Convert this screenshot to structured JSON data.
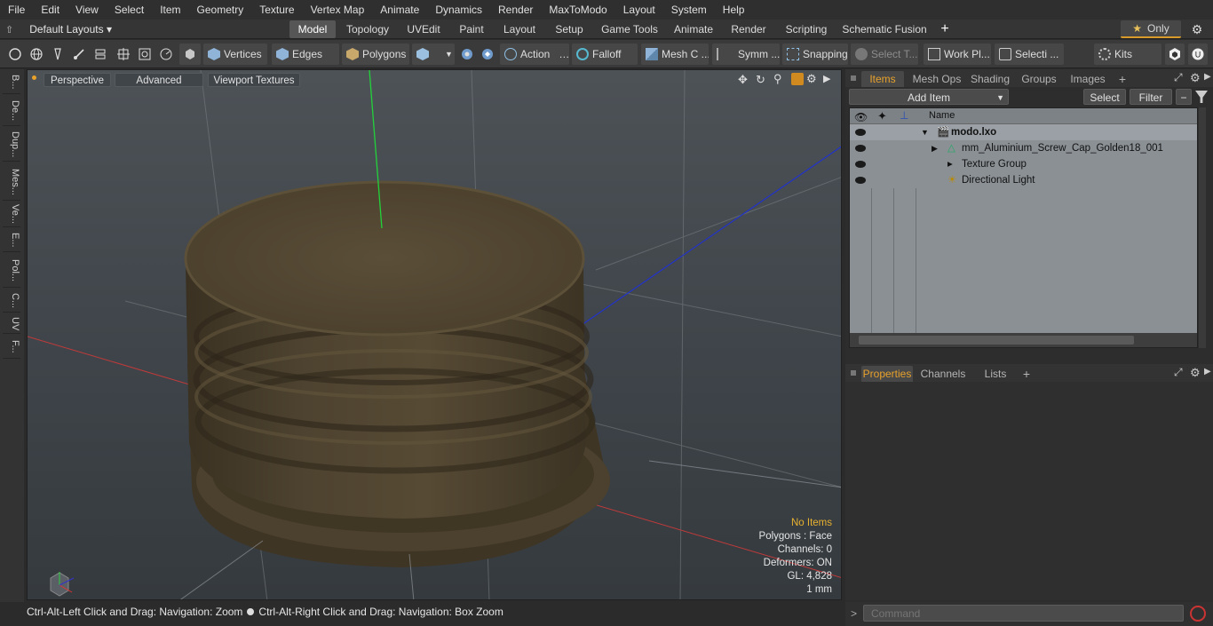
{
  "menu": [
    "File",
    "Edit",
    "View",
    "Select",
    "Item",
    "Geometry",
    "Texture",
    "Vertex Map",
    "Animate",
    "Dynamics",
    "Render",
    "MaxToModo",
    "Layout",
    "System",
    "Help"
  ],
  "layouts": {
    "label": "Default Layouts ▾"
  },
  "mode_tabs": [
    "Model",
    "Topology",
    "UVEdit",
    "Paint",
    "Layout",
    "Setup",
    "Game Tools",
    "Animate",
    "Render",
    "Scripting",
    "Schematic Fusion"
  ],
  "only": {
    "label": "Only",
    "star": "★"
  },
  "toolbar": {
    "vertices": "Vertices",
    "edges": "Edges",
    "polygons": "Polygons",
    "action": "Action",
    "falloff": "Falloff",
    "mesh": "Mesh C ...",
    "symm": "Symm ...",
    "snapping": "Snapping",
    "select_t": "Select T...",
    "work_pl": "Work Pl...",
    "selecti": "Selecti ...",
    "kits": "Kits"
  },
  "left_tabs": [
    "B...",
    "De...",
    "Dup...",
    "Mes...",
    "Ve...",
    "E...",
    "Pol...",
    "C...",
    "UV",
    "F..."
  ],
  "viewport": {
    "perspective": "Perspective",
    "advanced": "Advanced",
    "textures": "Viewport Textures"
  },
  "stats": {
    "no_items": "No Items",
    "polygons": "Polygons : Face",
    "channels": "Channels: 0",
    "deformers": "Deformers: ON",
    "gl": "GL: 4,828",
    "unit": "1 mm"
  },
  "status": {
    "left": "Ctrl-Alt-Left Click and Drag: Navigation: Zoom",
    "right": "Ctrl-Alt-Right Click and Drag: Navigation: Box Zoom"
  },
  "items_tabs": [
    "Items",
    "Mesh Ops",
    "Shading",
    "Groups",
    "Images"
  ],
  "items_toolbar": {
    "add": "Add Item",
    "select": "Select",
    "filter": "Filter"
  },
  "items_header": {
    "name": "Name"
  },
  "items": [
    {
      "label": "modo.lxo"
    },
    {
      "label": "mm_Aluminium_Screw_Cap_Golden18_001"
    },
    {
      "label": "Texture Group"
    },
    {
      "label": "Directional Light"
    }
  ],
  "props_tabs": [
    "Properties",
    "Channels",
    "Lists"
  ],
  "command": {
    "placeholder": "Command"
  },
  "colors": {
    "accent": "#e8a22b",
    "viewport_bg": "#43484d",
    "cap": "#4a3f2c"
  }
}
